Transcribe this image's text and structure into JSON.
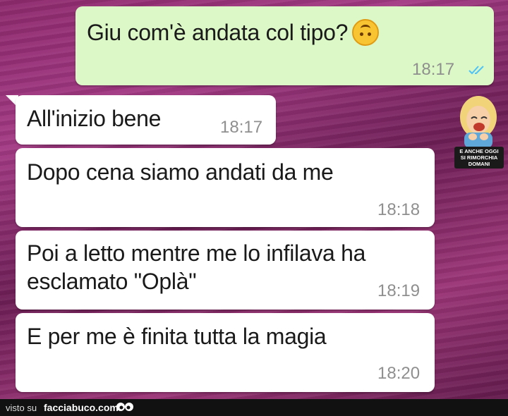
{
  "chat": {
    "messages": [
      {
        "direction": "outgoing",
        "text": "Giu com'è andata col tipo?",
        "time": "18:17",
        "emoji": "upside-down-face",
        "status": "read"
      },
      {
        "direction": "incoming",
        "text": "All'inizio bene",
        "time": "18:17"
      },
      {
        "direction": "incoming",
        "text": "Dopo cena siamo andati da me",
        "time": "18:18"
      },
      {
        "direction": "incoming",
        "text_line1": "Poi a letto mentre me lo infilava ha",
        "text_line2": "esclamato \"Oplà\"",
        "time": "18:19"
      },
      {
        "direction": "incoming",
        "text": "E per me è finita tutta la magia",
        "time": "18:20"
      }
    ]
  },
  "sticker": {
    "caption_line1": "E ANCHE OGGI",
    "caption_line2": "SI RIMORCHIA DOMANI",
    "icon": "laughing-woman-sticker"
  },
  "footer": {
    "visto": "visto su",
    "brand": "facciabuco.com",
    "icon": "eyes-icon"
  },
  "colors": {
    "outgoing_bubble": "#dcf8c6",
    "incoming_bubble": "#ffffff",
    "read_ticks": "#4fc3f7",
    "background": "#8e2a6e"
  }
}
